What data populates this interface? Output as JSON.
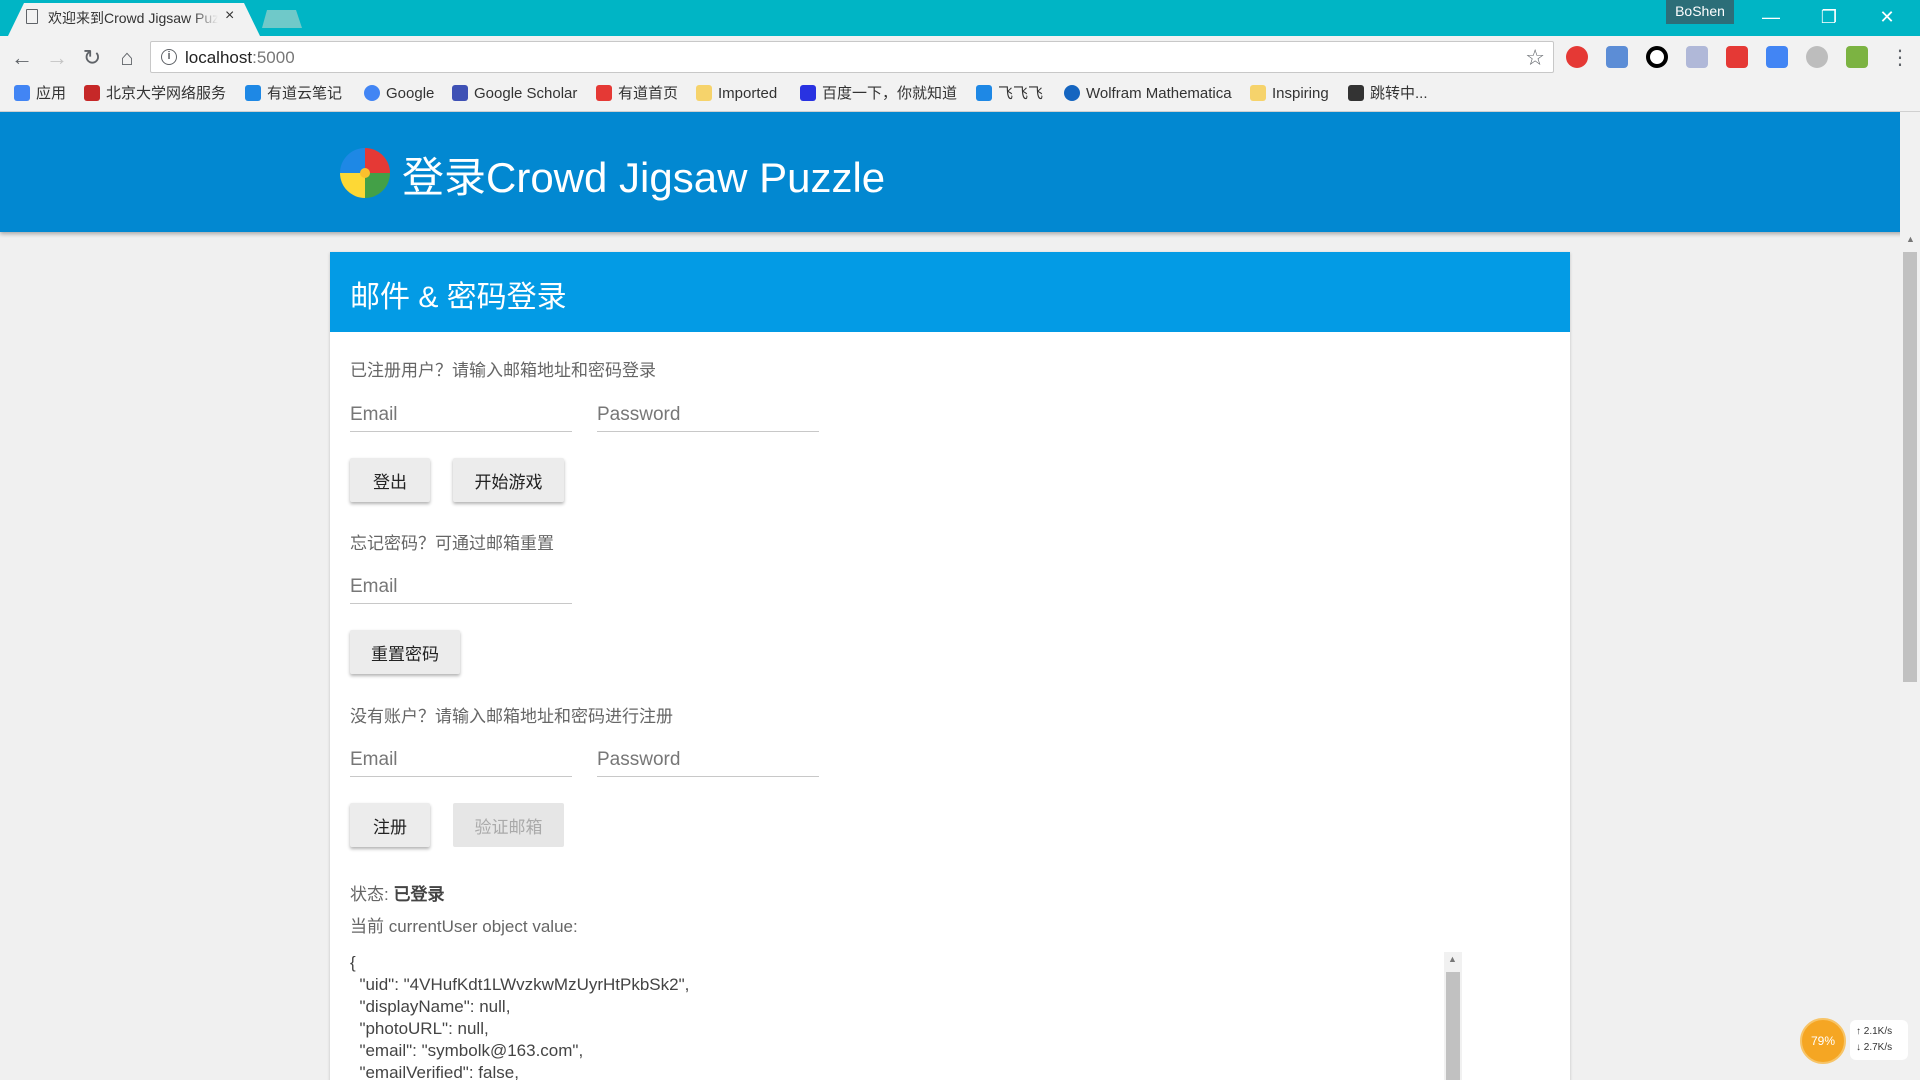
{
  "browser": {
    "tab_title": "欢迎来到Crowd Jigsaw Puzzle",
    "tab_close": "×",
    "profile_name": "BoShen",
    "url_host": "localhost",
    "url_port": ":5000",
    "win_minimize": "—",
    "win_restore": "❐",
    "win_close": "✕"
  },
  "bookmarks": [
    {
      "label": "应用",
      "icon": "apps-grid-icon",
      "color": "#4285f4"
    },
    {
      "label": "北京大学网络服务",
      "icon": "pku-icon",
      "color": "#c62828"
    },
    {
      "label": "有道云笔记",
      "icon": "youdao-note-icon",
      "color": "#1e88e5"
    },
    {
      "label": "Google",
      "icon": "google-icon",
      "color": "#4285f4"
    },
    {
      "label": "Google Scholar",
      "icon": "scholar-icon",
      "color": "#3f51b5"
    },
    {
      "label": "有道首页",
      "icon": "youdao-icon",
      "color": "#e53935"
    },
    {
      "label": "Imported",
      "icon": "folder-icon",
      "color": "#f6d36b"
    },
    {
      "label": "百度一下，你就知道",
      "icon": "baidu-icon",
      "color": "#2932e1"
    },
    {
      "label": "飞飞飞",
      "icon": "note-icon",
      "color": "#1e88e5"
    },
    {
      "label": "Wolfram Mathematica",
      "icon": "wolfram-icon",
      "color": "#1565c0"
    },
    {
      "label": "Inspiring",
      "icon": "folder-icon",
      "color": "#f6d36b"
    },
    {
      "label": "跳转中...",
      "icon": "gitzip-icon",
      "color": "#333333"
    }
  ],
  "app": {
    "title": "登录Crowd Jigsaw Puzzle",
    "card_title": "邮件 & 密码登录",
    "login_prompt": "已注册用户？请输入邮箱地址和密码登录",
    "email_placeholder": "Email",
    "password_placeholder": "Password",
    "logout_button": "登出",
    "start_button": "开始游戏",
    "reset_prompt": "忘记密码？可通过邮箱重置",
    "reset_button": "重置密码",
    "signup_prompt": "没有账户？请输入邮箱地址和密码进行注册",
    "signup_button": "注册",
    "verify_button": "验证邮箱",
    "status_label": "状态: ",
    "status_value": "已登录",
    "current_user_label": "当前 currentUser object value:",
    "user_json": "{\n  \"uid\": \"4VHufKdt1LWvzkwMzUyrHtPkbSk2\",\n  \"displayName\": null,\n  \"photoURL\": null,\n  \"email\": \"symbolk@163.com\",\n  \"emailVerified\": false,"
  },
  "netmonitor": {
    "percent": "79%",
    "up": "2.1K/s",
    "down": "2.7K/s"
  },
  "colors": {
    "header": "#0288d1",
    "card_header": "#039be5",
    "tabstrip": "#00b5c5"
  }
}
